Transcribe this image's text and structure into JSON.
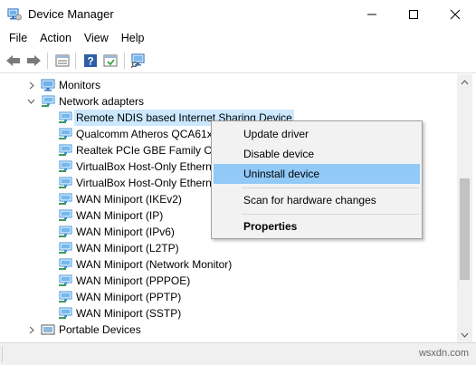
{
  "window": {
    "title": "Device Manager",
    "minimize_glyph": "minimize-icon",
    "maximize_glyph": "maximize-icon",
    "close_glyph": "close-icon"
  },
  "menu": [
    "File",
    "Action",
    "View",
    "Help"
  ],
  "toolbar": {
    "buttons": [
      "back-icon",
      "forward-icon",
      "properties-icon",
      "help-icon",
      "update-driver-icon",
      "scan-hardware-icon"
    ]
  },
  "tree": {
    "monitors": "Monitors",
    "network_adapters": "Network adapters",
    "adapters": [
      "Remote NDIS based Internet Sharing Device",
      "Qualcomm Atheros QCA61x",
      "Realtek PCIe GBE Family Cor",
      "VirtualBox Host-Only Ethern",
      "VirtualBox Host-Only Ethern",
      "WAN Miniport (IKEv2)",
      "WAN Miniport (IP)",
      "WAN Miniport (IPv6)",
      "WAN Miniport (L2TP)",
      "WAN Miniport (Network Monitor)",
      "WAN Miniport (PPPOE)",
      "WAN Miniport (PPTP)",
      "WAN Miniport (SSTP)"
    ],
    "portable_devices": "Portable Devices"
  },
  "context_menu": {
    "update_driver": "Update driver",
    "disable_device": "Disable device",
    "uninstall_device": "Uninstall device",
    "scan_hardware": "Scan for hardware changes",
    "properties": "Properties"
  },
  "status": {
    "watermark": "wsxdn.com"
  },
  "colors": {
    "selection": "#cce8ff",
    "menu_hover": "#91c9f7",
    "network_icon": "#3c8fd8",
    "monitor_icon": "#2f79c9"
  }
}
